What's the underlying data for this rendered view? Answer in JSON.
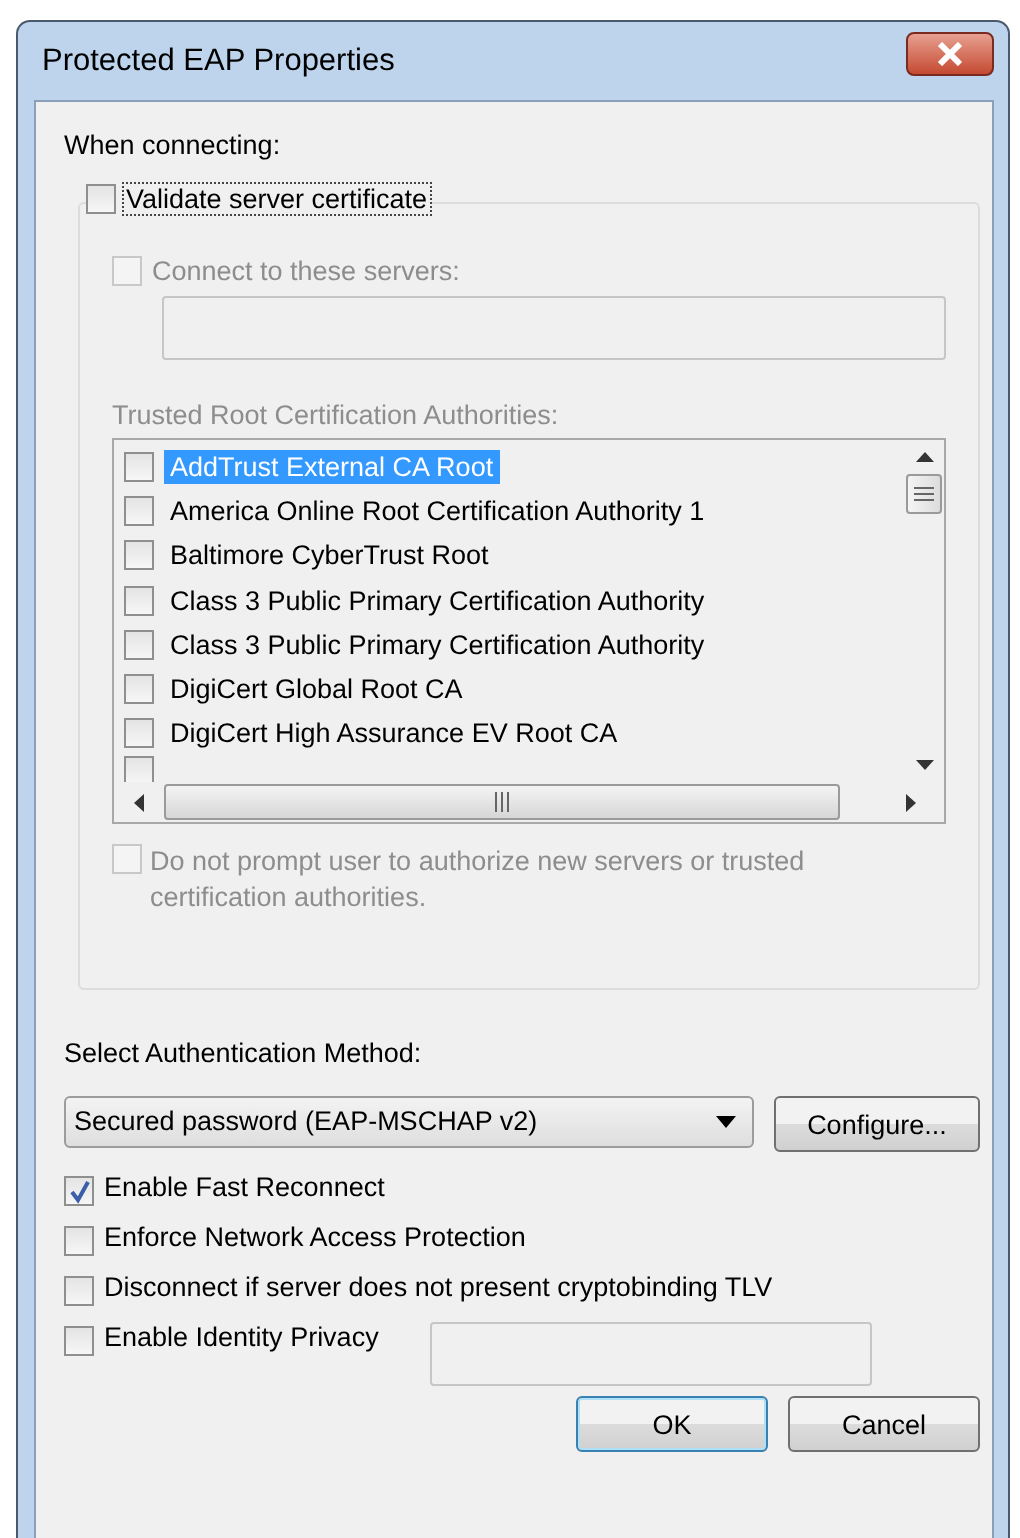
{
  "window": {
    "title": "Protected EAP Properties"
  },
  "when_connecting_label": "When connecting:",
  "validate_server_certificate": {
    "label": "Validate server certificate",
    "checked": false
  },
  "connect_to_servers": {
    "label": "Connect to these servers:",
    "checked": false,
    "disabled": true
  },
  "trusted_root_label": "Trusted Root Certification Authorities:",
  "certificate_list": [
    {
      "label": "AddTrust External CA Root",
      "checked": false,
      "selected": true
    },
    {
      "label": "America Online Root Certification Authority 1",
      "checked": false,
      "selected": false
    },
    {
      "label": "Baltimore CyberTrust Root",
      "checked": false,
      "selected": false
    },
    {
      "label": "Class 3 Public Primary Certification Authority",
      "checked": false,
      "selected": false
    },
    {
      "label": "Class 3 Public Primary Certification Authority",
      "checked": false,
      "selected": false
    },
    {
      "label": "DigiCert Global Root CA",
      "checked": false,
      "selected": false
    },
    {
      "label": "DigiCert High Assurance EV Root CA",
      "checked": false,
      "selected": false
    }
  ],
  "certificate_list_cut_row": {
    "checked": false
  },
  "do_not_prompt": {
    "label": "Do not prompt user to authorize new servers or trusted certification authorities.",
    "checked": false,
    "disabled": true
  },
  "auth_method_label": "Select Authentication Method:",
  "auth_method": {
    "value": "Secured password (EAP-MSCHAP v2)"
  },
  "configure_button": "Configure...",
  "options": [
    {
      "label": "Enable Fast Reconnect",
      "checked": true
    },
    {
      "label": "Enforce Network Access Protection",
      "checked": false
    },
    {
      "label": "Disconnect if server does not present cryptobinding TLV",
      "checked": false
    },
    {
      "label": "Enable Identity Privacy",
      "checked": false
    }
  ],
  "buttons": [
    {
      "label": "OK",
      "default": true
    },
    {
      "label": "Cancel",
      "default": false
    }
  ]
}
